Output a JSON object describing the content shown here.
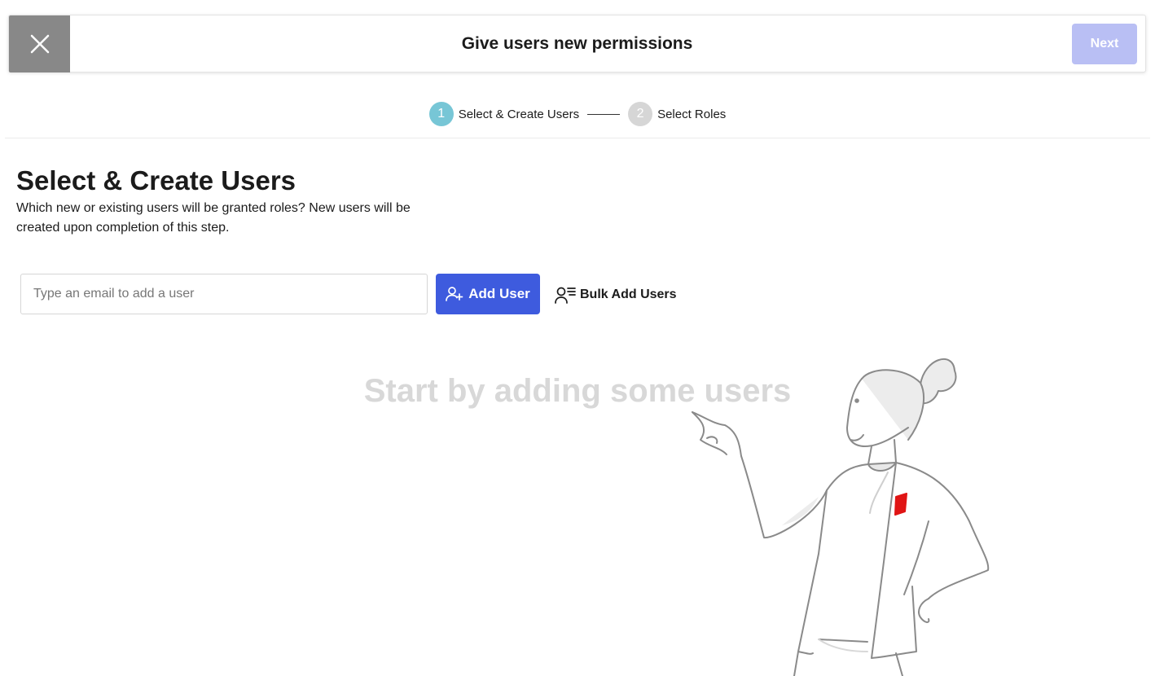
{
  "header": {
    "title": "Give users new permissions",
    "next_label": "Next",
    "accent_disabled": "#b9bff4",
    "close_icon": "close-icon"
  },
  "stepper": {
    "steps": [
      {
        "number": "1",
        "label": "Select & Create Users",
        "state": "active",
        "color": "#77c6d6"
      },
      {
        "number": "2",
        "label": "Select Roles",
        "state": "inactive",
        "color": "#d6d6d6"
      }
    ]
  },
  "main": {
    "title": "Select & Create Users",
    "description": "Which new or existing users will be granted roles? New users will be created upon completion of this step.",
    "email_input": {
      "value": "",
      "placeholder": "Type an email to add a user"
    },
    "add_user_label": "Add User",
    "add_user_icon": "add-user-icon",
    "bulk_add_label": "Bulk Add Users",
    "bulk_add_icon": "user-list-icon",
    "primary_color": "#3e5bde",
    "empty_state": "Start by adding some users",
    "illustration": "woman-pointing-illustration"
  }
}
